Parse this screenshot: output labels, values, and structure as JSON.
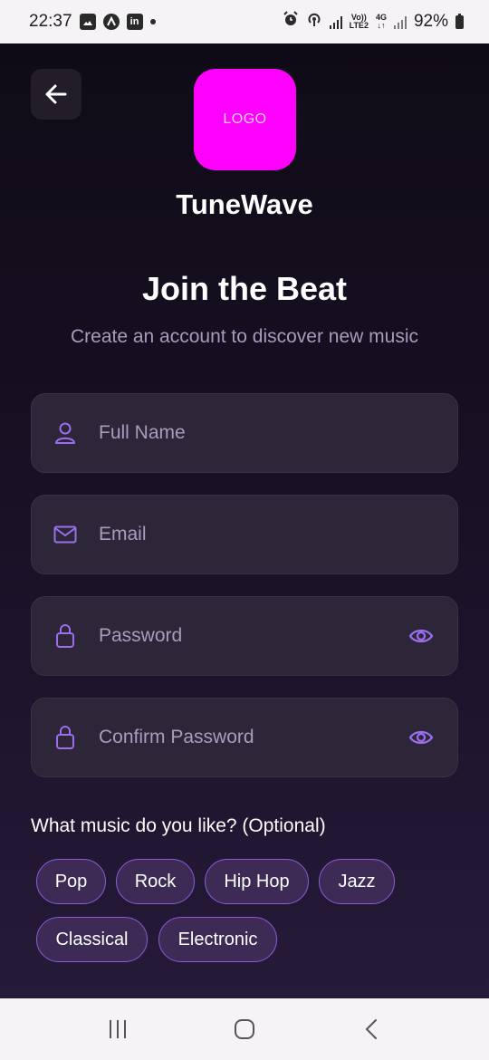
{
  "status_bar": {
    "time": "22:37",
    "battery": "92%",
    "network_top": "Vo))",
    "network_bottom": "LTE2",
    "data_top": "4G",
    "data_bottom": "↓↑",
    "icons": [
      "image-icon",
      "a-icon",
      "linkedin-icon",
      "dot",
      "alarm-icon",
      "hotspot-icon",
      "signal-icon",
      "signal-icon",
      "battery-icon"
    ]
  },
  "header": {
    "back_icon": "arrow-left-icon",
    "logo_text": "LOGO",
    "app_name": "TuneWave"
  },
  "main": {
    "title": "Join the Beat",
    "subtitle": "Create an account to discover new music"
  },
  "form": {
    "full_name": {
      "placeholder": "Full Name",
      "value": "",
      "icon": "user-icon"
    },
    "email": {
      "placeholder": "Email",
      "value": "",
      "icon": "mail-icon"
    },
    "password": {
      "placeholder": "Password",
      "value": "",
      "icon": "lock-icon",
      "toggle_icon": "eye-icon"
    },
    "confirm_password": {
      "placeholder": "Confirm Password",
      "value": "",
      "icon": "lock-icon",
      "toggle_icon": "eye-icon"
    }
  },
  "genres": {
    "label": "What music do you like? (Optional)",
    "chips": [
      "Pop",
      "Rock",
      "Hip Hop",
      "Jazz",
      "Classical",
      "Electronic"
    ]
  },
  "nav_bar": {
    "icons": [
      "recent-apps-icon",
      "home-icon",
      "back-nav-icon"
    ]
  },
  "colors": {
    "accent": "#9b6ef0",
    "logo": "#ff00ff",
    "chip_bg": "#3d2a55",
    "field_bg": "#2d2538"
  }
}
